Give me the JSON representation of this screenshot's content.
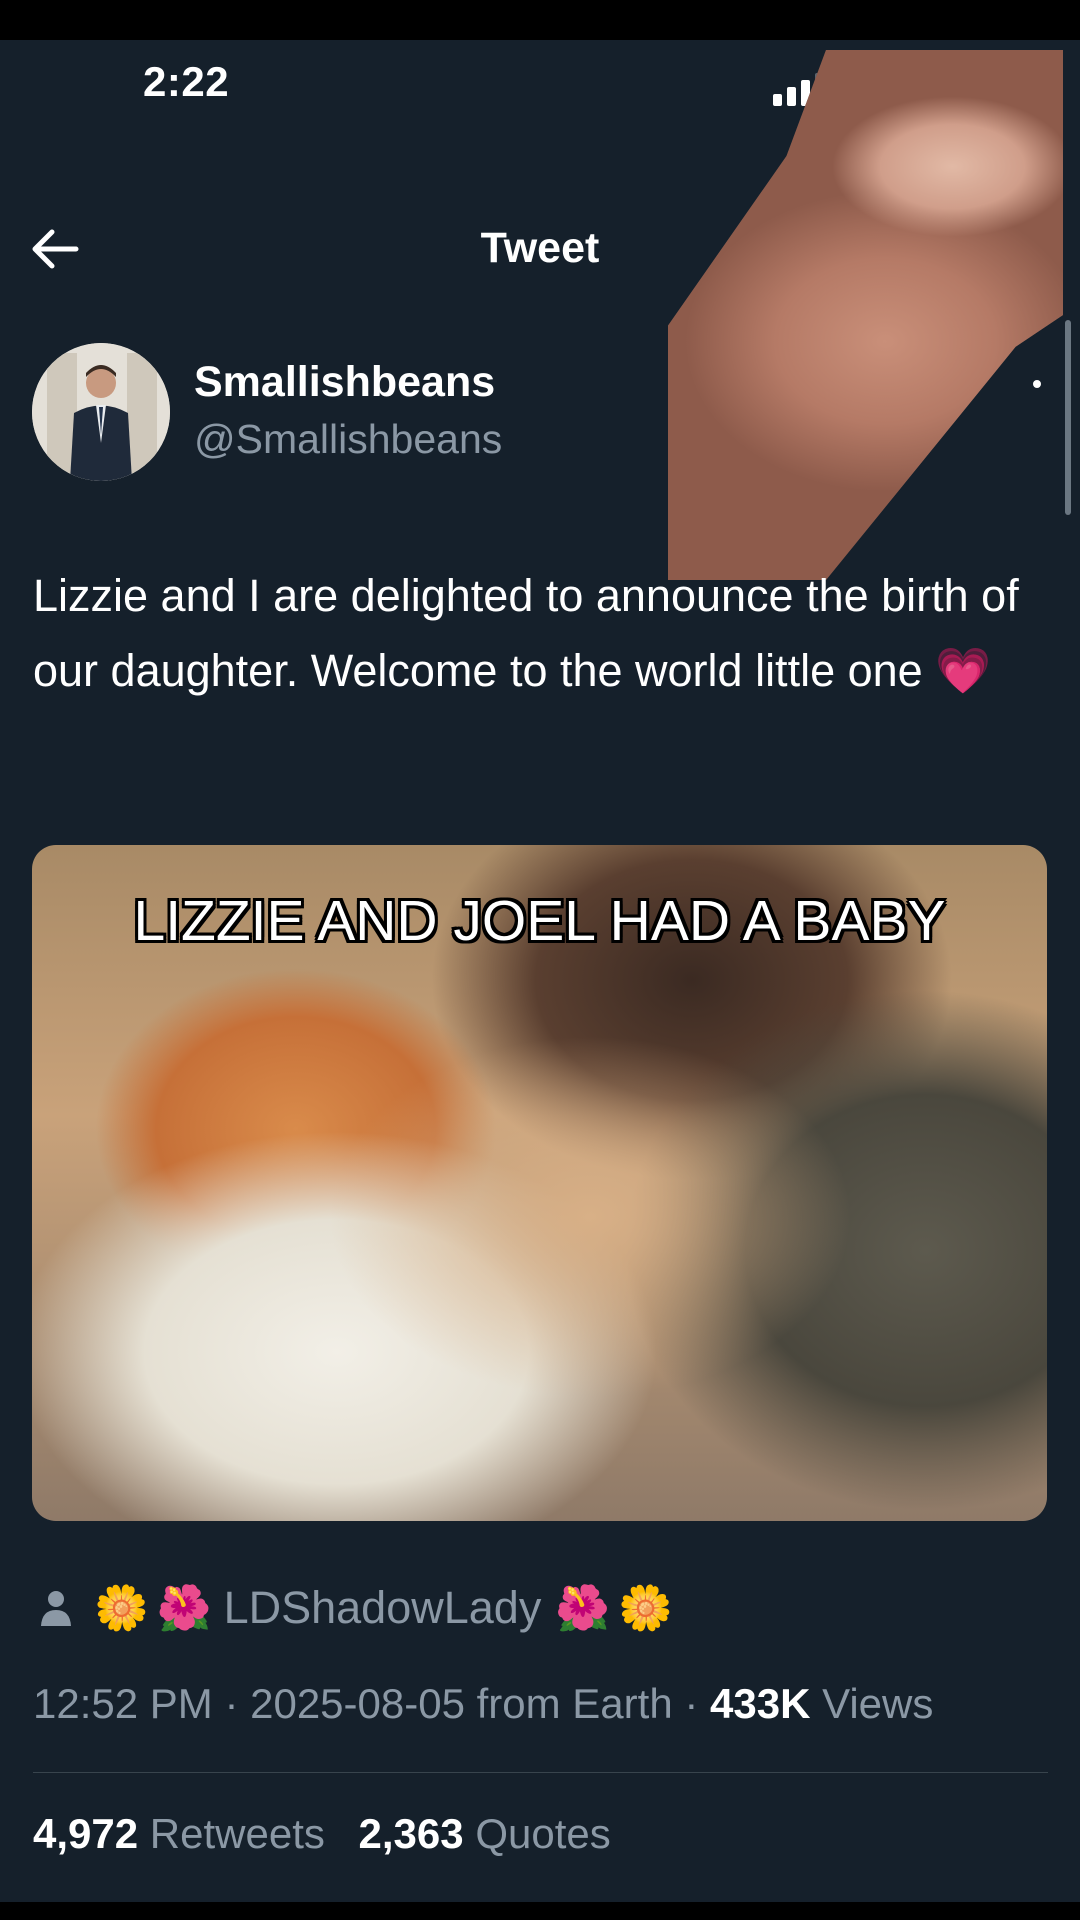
{
  "status_bar": {
    "time": "2:22"
  },
  "header": {
    "title": "Tweet"
  },
  "author": {
    "display_name": "Smallishbeans",
    "handle": "@Smallishbeans"
  },
  "tweet": {
    "text": "Lizzie and I are delighted to announce the birth of our daughter. Welcome to the world little one",
    "emoji": "💗"
  },
  "media": {
    "caption": "LIZZIE AND JOEL HAD A BABY"
  },
  "audience": {
    "emoji_left": [
      "🌼",
      "🌺"
    ],
    "name": "LDShadowLady",
    "emoji_right": [
      "🌺",
      "🌼"
    ]
  },
  "meta": {
    "time": "12:52 PM",
    "date": "2025-08-05",
    "source": "from Earth",
    "views_count": "433K",
    "views_label": "Views"
  },
  "stats": {
    "retweets_count": "4,972",
    "retweets_label": "Retweets",
    "quotes_count": "2,363",
    "quotes_label": "Quotes"
  },
  "colors": {
    "background": "#15202b",
    "secondary_text": "#8b98a5",
    "heart": "#e426b8"
  }
}
